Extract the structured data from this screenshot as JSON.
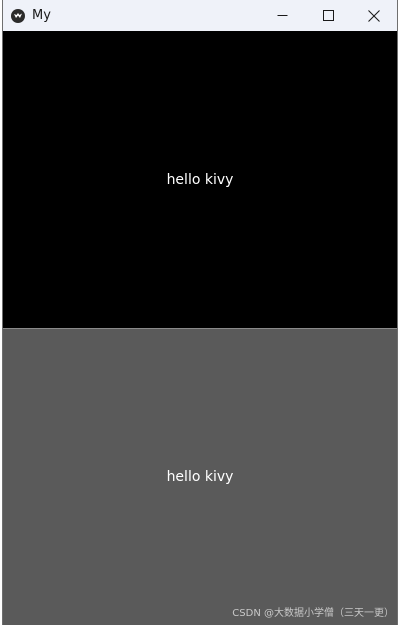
{
  "window": {
    "title": "My",
    "app_icon": "kivy-logo-icon",
    "controls": [
      "minimize-icon",
      "maximize-icon",
      "close-icon"
    ]
  },
  "buttons": [
    {
      "label": "hello kivy",
      "background": "#000000"
    },
    {
      "label": "hello kivy",
      "background": "#5a5a5a"
    }
  ],
  "watermark": "CSDN @大数据小学僧（三天一更）"
}
